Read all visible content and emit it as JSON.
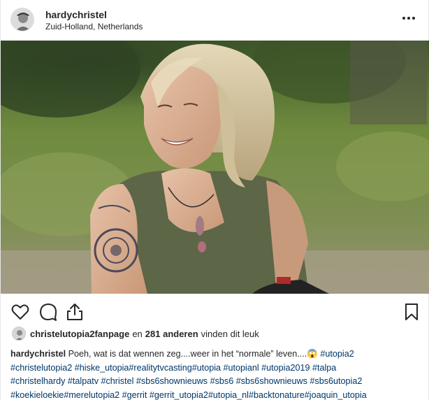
{
  "header": {
    "username": "hardychristel",
    "location": "Zuid-Holland, Netherlands"
  },
  "icons": {
    "like": "heart-icon",
    "comment": "comment-icon",
    "share": "share-icon",
    "save": "bookmark-icon",
    "more": "more-horizontal-icon"
  },
  "likes": {
    "user": "christelutopia2fanpage",
    "connector": "en",
    "others": "281 anderen",
    "suffix": "vinden dit leuk"
  },
  "caption": {
    "username": "hardychristel",
    "text": "Poeh, wat is dat wennen zeg....weer in het “normale” leven....",
    "emoji": "😱",
    "lines": [
      "#utopia2",
      "#christelutopia2 #hiske_utopia#realitytvcasting#utopia #utopianl #utopia2019 #talpa",
      "#christelhardy #talpatv #christel #sbs6shownieuws #sbs6 #sbs6shownieuws #sbs6utopia2",
      "#koekieloekie#merelutopia2 #gerrit #gerrit_utopia2#utopia_nl#backtonature#joaquin_utopia"
    ]
  },
  "colors": {
    "text": "#262626",
    "hashtag": "#003569",
    "border": "#e6e6e6"
  }
}
